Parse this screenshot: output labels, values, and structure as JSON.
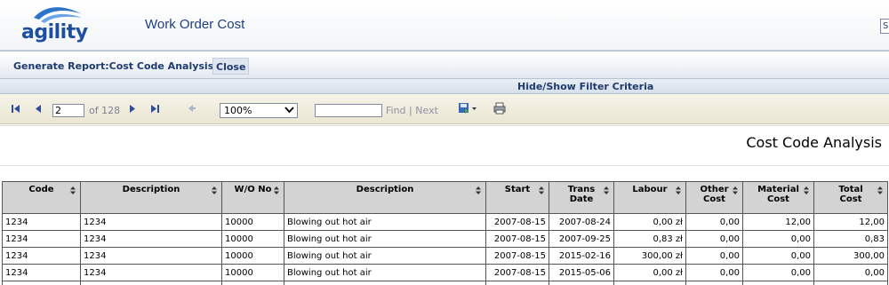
{
  "app": {
    "logo_text": "agility",
    "title": "Work Order Cost",
    "search_stub": "S"
  },
  "menu": {
    "generate_report": "Generate Report:Cost Code Analysis",
    "close": "Close"
  },
  "filter_toggle": "Hide/Show Filter Criteria",
  "toolbar": {
    "page_value": "2",
    "page_of": "of 128",
    "zoom": "100%",
    "find_value": "",
    "find_label": "Find",
    "separator": "|",
    "next_label": "Next",
    "icons": [
      "first-page-icon",
      "prev-page-icon",
      "next-page-icon",
      "last-page-icon",
      "back-icon",
      "export-icon",
      "print-icon"
    ]
  },
  "report": {
    "title": "Cost Code Analysis",
    "columns": [
      {
        "label": "Code",
        "label2": ""
      },
      {
        "label": "Description",
        "label2": ""
      },
      {
        "label": "W/O No",
        "label2": ""
      },
      {
        "label": "Description",
        "label2": ""
      },
      {
        "label": "Start",
        "label2": ""
      },
      {
        "label": "Trans",
        "label2": "Date"
      },
      {
        "label": "Labour",
        "label2": ""
      },
      {
        "label": "Other",
        "label2": "Cost"
      },
      {
        "label": "Material",
        "label2": "Cost"
      },
      {
        "label": "Total",
        "label2": "Cost"
      }
    ],
    "rows": [
      [
        "1234",
        "1234",
        "10000",
        "Blowing out hot air",
        "2007-08-15",
        "2007-08-24",
        "0,00 zł",
        "0,00",
        "12,00",
        "12,00"
      ],
      [
        "1234",
        "1234",
        "10000",
        "Blowing out hot air",
        "2007-08-15",
        "2007-09-25",
        "0,83 zł",
        "0,00",
        "0,00",
        "0,83"
      ],
      [
        "1234",
        "1234",
        "10000",
        "Blowing out hot air",
        "2007-08-15",
        "2015-02-16",
        "300,00 zł",
        "0,00",
        "0,00",
        "300,00"
      ],
      [
        "1234",
        "1234",
        "10000",
        "Blowing out hot air",
        "2007-08-15",
        "2015-05-06",
        "0,00 zł",
        "0,00",
        "0,00",
        "0,00"
      ],
      [
        "",
        "",
        "",
        "",
        "",
        "",
        "",
        "",
        "",
        ""
      ]
    ]
  },
  "colors": {
    "brand": "#1d4fa0",
    "title": "#1f3f7a",
    "header_bg": "#d3d3d3"
  }
}
